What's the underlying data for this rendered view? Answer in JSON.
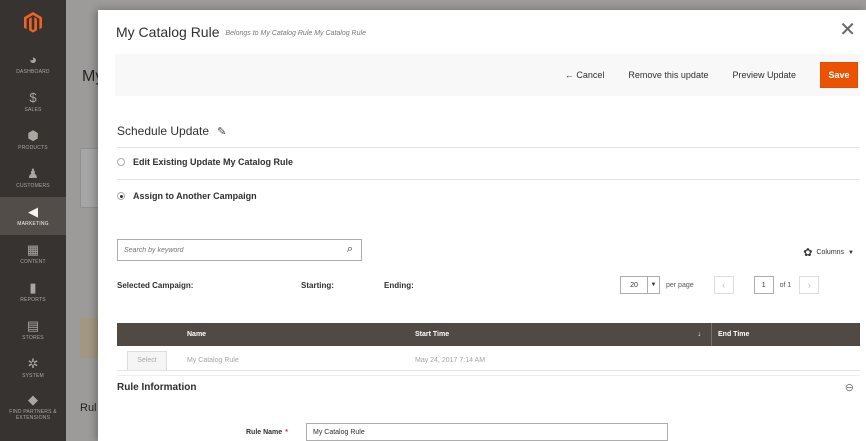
{
  "sidebar": {
    "items": [
      {
        "icon": "dashboard-icon",
        "glyph": "◕",
        "label": "DASHBOARD"
      },
      {
        "icon": "dollar-icon",
        "glyph": "$",
        "label": "SALES"
      },
      {
        "icon": "cube-icon",
        "glyph": "⬢",
        "label": "PRODUCTS"
      },
      {
        "icon": "person-icon",
        "glyph": "♟",
        "label": "CUSTOMERS"
      },
      {
        "icon": "megaphone-icon",
        "glyph": "◀",
        "label": "MARKETING"
      },
      {
        "icon": "content-icon",
        "glyph": "▦",
        "label": "CONTENT"
      },
      {
        "icon": "bar-chart-icon",
        "glyph": "▮",
        "label": "REPORTS"
      },
      {
        "icon": "store-icon",
        "glyph": "▤",
        "label": "STORES"
      },
      {
        "icon": "gear-icon",
        "glyph": "✲",
        "label": "SYSTEM"
      },
      {
        "icon": "partners-icon",
        "glyph": "◆",
        "label": "FIND PARTNERS & EXTENSIONS"
      }
    ]
  },
  "background": {
    "title_fragment": "My",
    "rule_fragment": "Rul"
  },
  "modal": {
    "title": "My Catalog Rule",
    "subtitle": "Belongs to My Catalog Rule My Catalog Rule",
    "close_glyph": "✕",
    "actions": {
      "cancel": "← Cancel",
      "remove": "Remove this update",
      "preview": "Preview Update",
      "save": "Save"
    },
    "schedule_title": "Schedule Update",
    "radio_existing": "Edit Existing Update My Catalog Rule",
    "radio_assign": "Assign to Another Campaign",
    "search_placeholder": "Search by keyword",
    "columns_label": "Columns",
    "selected_campaign": "Selected Campaign:",
    "starting": "Starting:",
    "ending": "Ending:",
    "per_page_value": "20",
    "per_page_label": "per page",
    "page_current": "1",
    "page_of": "of 1",
    "grid": {
      "columns": [
        "Name",
        "Start Time",
        "End Time"
      ],
      "sort_glyph": "↓",
      "rows": [
        {
          "action": "Select",
          "name": "My Catalog Rule",
          "start": "May 24, 2017 7:14 AM",
          "end": ""
        }
      ]
    },
    "rule_info_title": "Rule Information",
    "rule_name_label": "Rule Name",
    "rule_name_value": "My Catalog Rule"
  }
}
